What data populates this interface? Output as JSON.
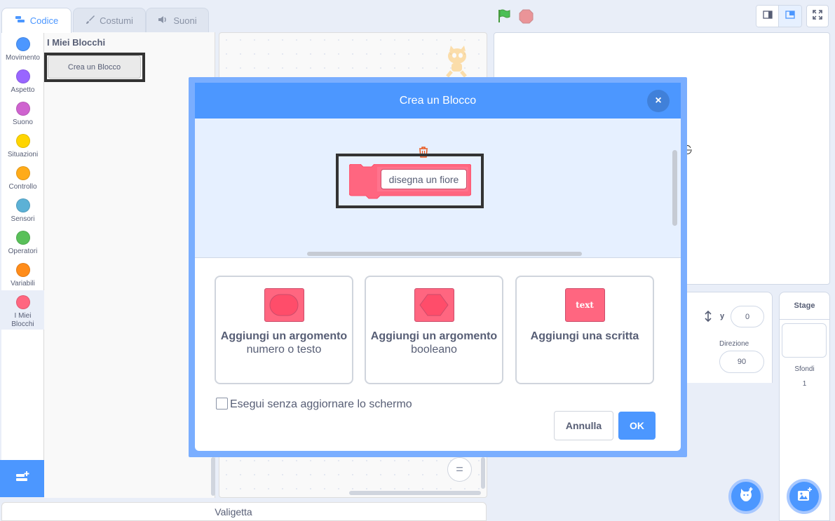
{
  "tabs": [
    {
      "label": "Codice",
      "icon": "code-icon",
      "active": true
    },
    {
      "label": "Costumi",
      "icon": "brush-icon",
      "active": false
    },
    {
      "label": "Suoni",
      "icon": "speaker-icon",
      "active": false
    }
  ],
  "categories": [
    {
      "label": "Movimento",
      "color": "#4c97ff"
    },
    {
      "label": "Aspetto",
      "color": "#9966ff"
    },
    {
      "label": "Suono",
      "color": "#cf63cf"
    },
    {
      "label": "Situazioni",
      "color": "#ffd500"
    },
    {
      "label": "Controllo",
      "color": "#ffab19"
    },
    {
      "label": "Sensori",
      "color": "#5cb1d6"
    },
    {
      "label": "Operatori",
      "color": "#59c059"
    },
    {
      "label": "Variabili",
      "color": "#ff8c1a"
    },
    {
      "label": "I Miei Blocchi",
      "color": "#ff6680",
      "selected": true
    }
  ],
  "palette": {
    "title": "I Miei Blocchi",
    "make_block_label": "Crea un Blocco"
  },
  "scripts": {
    "zoom_reset_label": "="
  },
  "backpack": {
    "label": "Valigetta"
  },
  "sprite_info": {
    "y_label": "y",
    "y_value": "0",
    "direction_label": "Direzione",
    "direction_value": "90"
  },
  "stage_panel": {
    "title": "Stage",
    "backdrops_label": "Sfondi",
    "backdrops_count": "1"
  },
  "modal": {
    "title": "Crea un Blocco",
    "close_symbol": "×",
    "block_name": "disegna un fiore",
    "options": [
      {
        "title": "Aggiungi un argomento",
        "subtitle": "numero o testo",
        "icon": "oval-input-icon"
      },
      {
        "title": "Aggiungi un argomento",
        "subtitle": "booleano",
        "icon": "hexagon-input-icon"
      },
      {
        "title": "Aggiungi una scritta",
        "subtitle": "",
        "icon": "text-label-icon",
        "chip_text": "text"
      }
    ],
    "run_without_refresh_label": "Esegui senza aggiornare lo schermo",
    "run_without_refresh_checked": false,
    "cancel_label": "Annulla",
    "ok_label": "OK"
  },
  "colors": {
    "accent": "#4c97ff",
    "my_blocks": "#ff6680",
    "highlight": "#333333"
  }
}
